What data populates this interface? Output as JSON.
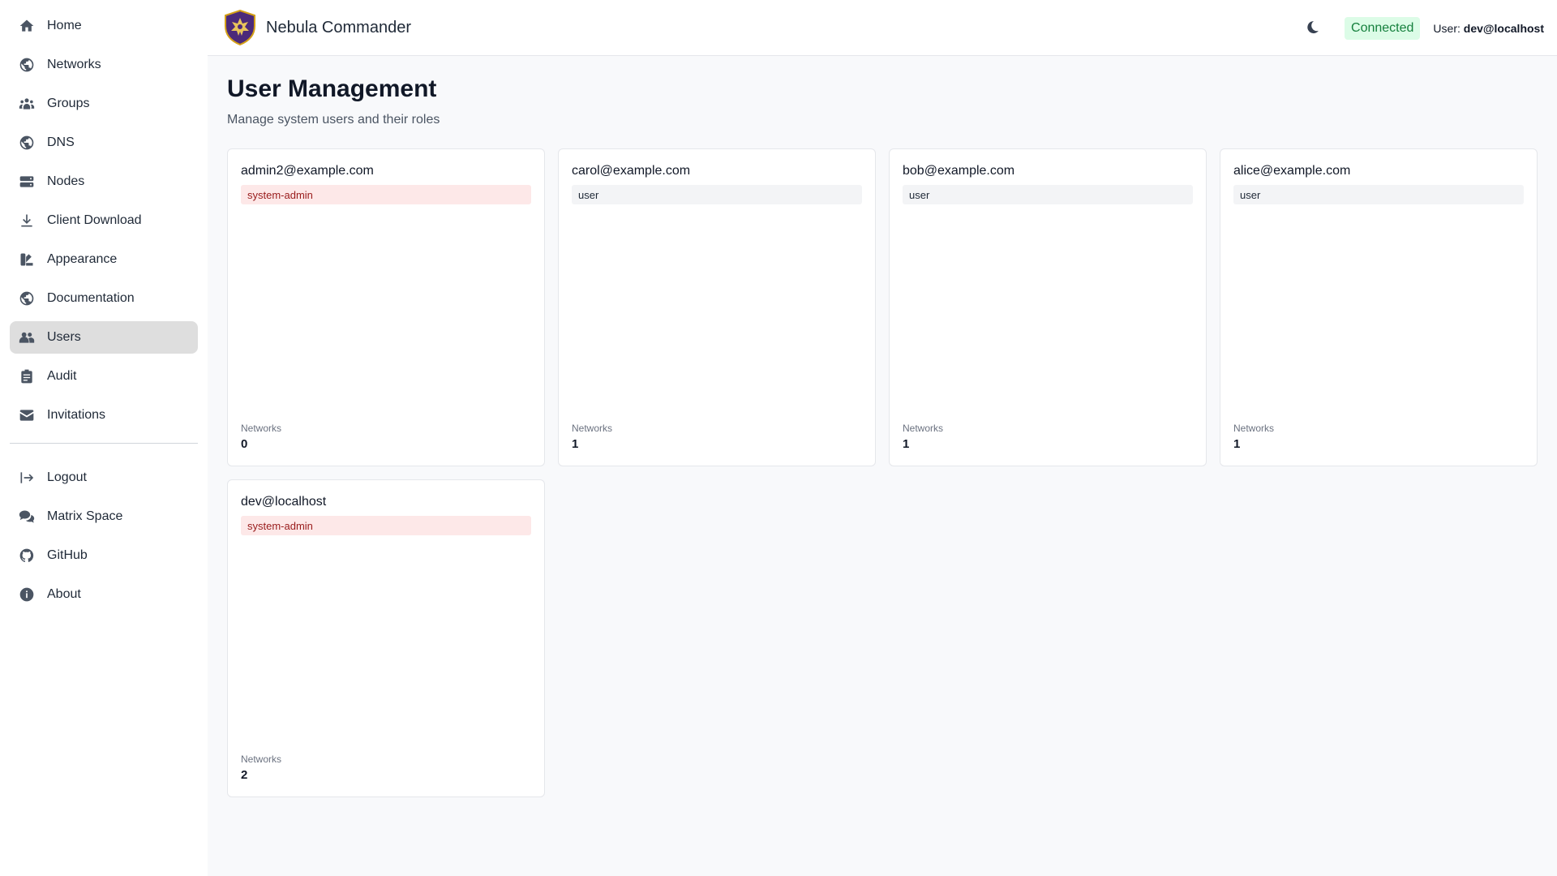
{
  "app": {
    "title": "Nebula Commander",
    "status": "Connected",
    "user_prefix": "User:",
    "user_name": "dev@localhost",
    "accent_color": "#4b2a7a",
    "status_color": "#15803d"
  },
  "sidebar": {
    "primary": [
      {
        "label": "Home",
        "icon": "home-icon"
      },
      {
        "label": "Networks",
        "icon": "globe-icon"
      },
      {
        "label": "Groups",
        "icon": "groups-icon"
      },
      {
        "label": "DNS",
        "icon": "globe-icon"
      },
      {
        "label": "Nodes",
        "icon": "server-icon"
      },
      {
        "label": "Client Download",
        "icon": "download-icon"
      },
      {
        "label": "Appearance",
        "icon": "palette-icon"
      },
      {
        "label": "Documentation",
        "icon": "globe-icon"
      },
      {
        "label": "Users",
        "icon": "users-icon",
        "active": true
      },
      {
        "label": "Audit",
        "icon": "clipboard-icon"
      },
      {
        "label": "Invitations",
        "icon": "envelope-icon"
      }
    ],
    "secondary": [
      {
        "label": "Logout",
        "icon": "logout-icon"
      },
      {
        "label": "Matrix Space",
        "icon": "chat-icon"
      },
      {
        "label": "GitHub",
        "icon": "github-icon"
      },
      {
        "label": "About",
        "icon": "info-icon"
      }
    ]
  },
  "page": {
    "title": "User Management",
    "subtitle": "Manage system users and their roles"
  },
  "users": [
    {
      "email": "admin2@example.com",
      "role": "system-admin",
      "networks_label": "Networks",
      "networks": "0"
    },
    {
      "email": "carol@example.com",
      "role": "user",
      "networks_label": "Networks",
      "networks": "1"
    },
    {
      "email": "bob@example.com",
      "role": "user",
      "networks_label": "Networks",
      "networks": "1"
    },
    {
      "email": "alice@example.com",
      "role": "user",
      "networks_label": "Networks",
      "networks": "1"
    },
    {
      "email": "dev@localhost",
      "role": "system-admin",
      "networks_label": "Networks",
      "networks": "2"
    }
  ]
}
